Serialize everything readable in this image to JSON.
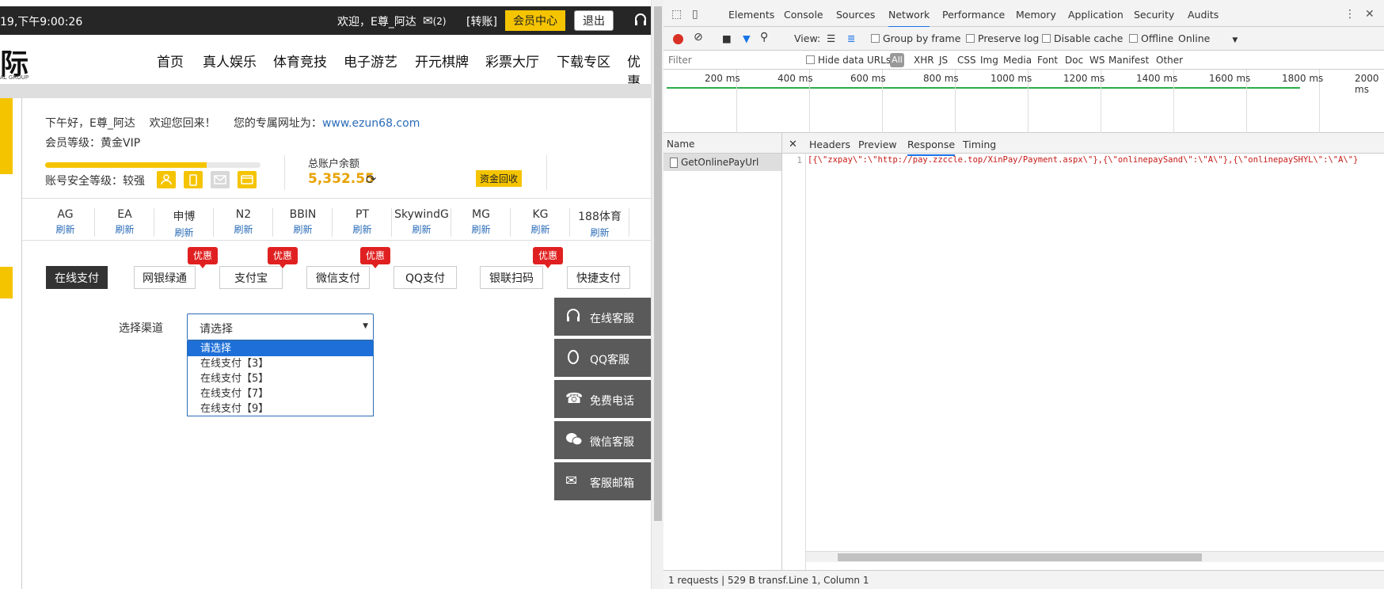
{
  "site": {
    "topbar": {
      "clock": "19,下午9:00:26",
      "welcome": "欢迎，E尊_阿达",
      "mail_count": "(2)",
      "transfer": "[转账]",
      "member_center": "会员中心",
      "logout": "退出"
    },
    "logo": {
      "text": "际",
      "sub": "AL GROUP"
    },
    "nav": [
      "首页",
      "真人娱乐",
      "体育竞技",
      "电子游艺",
      "开元棋牌",
      "彩票大厅",
      "下载专区",
      "优惠"
    ],
    "account": {
      "greeting": "下午好，E尊_阿达",
      "welcome_back": "欢迎您回来！",
      "url_label": "您的专属网址为：",
      "url": "www.ezun68.com",
      "level_label": "会员等级：",
      "level": "黄金VIP",
      "security_label": "账号安全等级：",
      "security": "较强",
      "security_progress": 0.75,
      "balance_label": "总账户余额",
      "balance": "5,352.55",
      "recover": "资金回收"
    },
    "platforms": [
      {
        "name": "AG",
        "action": "刷新"
      },
      {
        "name": "EA",
        "action": "刷新"
      },
      {
        "name": "申博",
        "action": "刷新"
      },
      {
        "name": "N2",
        "action": "刷新"
      },
      {
        "name": "BBIN",
        "action": "刷新"
      },
      {
        "name": "PT",
        "action": "刷新"
      },
      {
        "name": "SkywindG",
        "action": "刷新"
      },
      {
        "name": "MG",
        "action": "刷新"
      },
      {
        "name": "KG",
        "action": "刷新"
      },
      {
        "name": "188体育",
        "action": "刷新"
      }
    ],
    "payment_methods": [
      {
        "label": "在线支付",
        "active": true
      },
      {
        "label": "网银绿通",
        "promo": "优惠"
      },
      {
        "label": "支付宝",
        "promo": "优惠"
      },
      {
        "label": "微信支付",
        "promo": "优惠"
      },
      {
        "label": "QQ支付"
      },
      {
        "label": "银联扫码",
        "promo": "优惠"
      },
      {
        "label": "快捷支付"
      }
    ],
    "channel": {
      "label": "选择渠道",
      "selected": "请选择",
      "options": [
        "请选择",
        "在线支付【3】",
        "在线支付【5】",
        "在线支付【7】",
        "在线支付【9】"
      ]
    },
    "service": [
      {
        "icon": "headset-icon",
        "label": "在线客服"
      },
      {
        "icon": "qq-icon",
        "label": "QQ客服"
      },
      {
        "icon": "phone-icon",
        "label": "免费电话"
      },
      {
        "icon": "wechat-icon",
        "label": "微信客服"
      },
      {
        "icon": "mail-icon",
        "label": "客服邮箱"
      }
    ]
  },
  "devtools": {
    "tabs": [
      "Elements",
      "Console",
      "Sources",
      "Network",
      "Performance",
      "Memory",
      "Application",
      "Security",
      "Audits"
    ],
    "active_tab": "Network",
    "toolbar": {
      "view": "View:",
      "group_by_frame": "Group by frame",
      "preserve_log": "Preserve log",
      "disable_cache": "Disable cache",
      "offline": "Offline",
      "throttle": "Online"
    },
    "filter": {
      "placeholder": "Filter",
      "hide_data_urls": "Hide data URLs",
      "types": [
        "All",
        "XHR",
        "JS",
        "CSS",
        "Img",
        "Media",
        "Font",
        "Doc",
        "WS",
        "Manifest",
        "Other"
      ]
    },
    "timeline_labels": [
      "200 ms",
      "400 ms",
      "600 ms",
      "800 ms",
      "1000 ms",
      "1200 ms",
      "1400 ms",
      "1600 ms",
      "1800 ms",
      "2000 ms"
    ],
    "name_header": "Name",
    "requests": [
      "GetOnlinePayUrl"
    ],
    "detail_tabs": [
      "Headers",
      "Preview",
      "Response",
      "Timing"
    ],
    "active_detail": "Response",
    "line_number": "1",
    "response": "[{\\\"zxpay\\\":\\\"http://pay.zzccle.top/XinPay/Payment.aspx\\\"},{\\\"onlinepaySand\\\":\\\"A\\\"},{\\\"onlinepaySHYL\\\":\\\"A\\\"}",
    "status_left": "1 requests  |  529 B transf...",
    "status_right": "Line 1, Column 1"
  }
}
